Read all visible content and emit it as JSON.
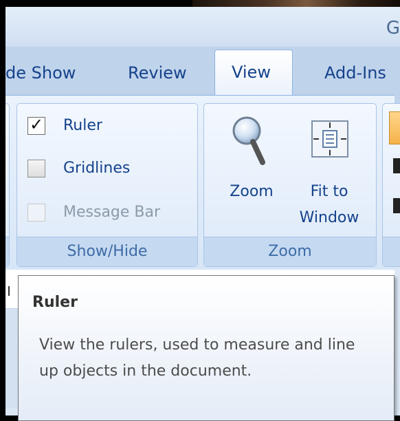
{
  "window": {
    "title_fragment": "G"
  },
  "tabs": [
    {
      "label": "de Show",
      "active": false
    },
    {
      "label": "Review",
      "active": false
    },
    {
      "label": "View",
      "active": true
    },
    {
      "label": "Add-Ins",
      "active": false
    }
  ],
  "show_hide": {
    "label": "Show/Hide",
    "items": [
      {
        "label": "Ruler",
        "checked": true,
        "enabled": true
      },
      {
        "label": "Gridlines",
        "checked": false,
        "enabled": true
      },
      {
        "label": "Message Bar",
        "checked": false,
        "enabled": false
      }
    ]
  },
  "zoom_group": {
    "label": "Zoom",
    "zoom_button": "Zoom",
    "fit_button_line1": "Fit to",
    "fit_button_line2": "Window"
  },
  "tooltip": {
    "title": "Ruler",
    "body": "View the rulers, used to measure and line up objects in the document."
  },
  "colors": {
    "ribbon_text": "#15428b",
    "tab_bar": "#bfd3eb",
    "accent_orange": "#f5b24a"
  }
}
